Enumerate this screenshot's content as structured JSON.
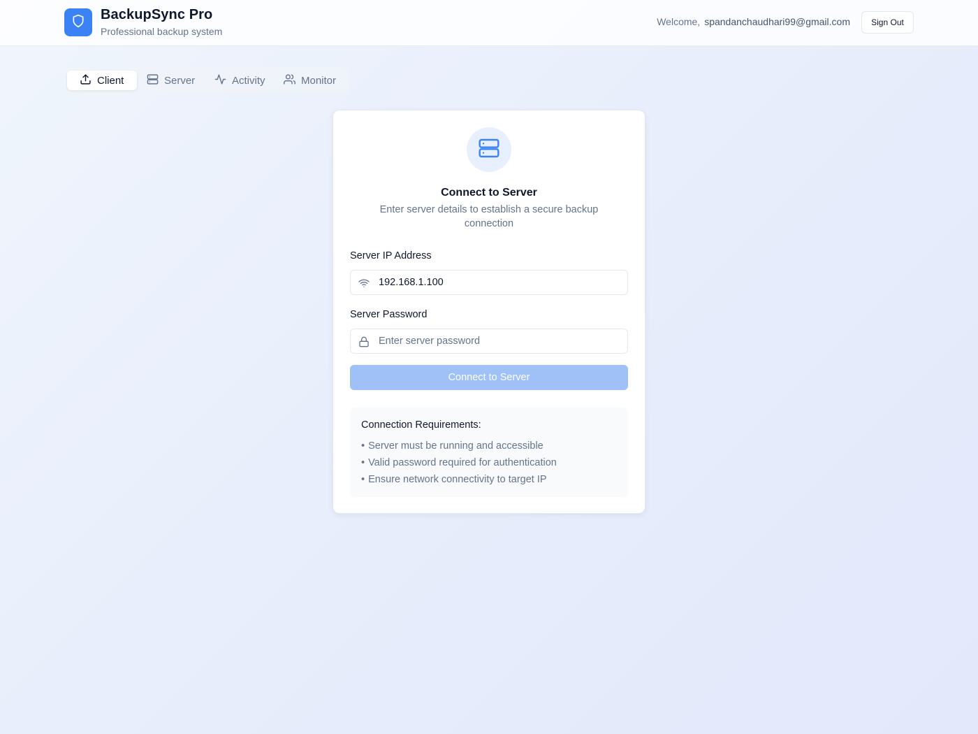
{
  "header": {
    "app_title": "BackupSync Pro",
    "app_subtitle": "Professional backup system",
    "welcome_label": "Welcome,",
    "user_email": "spandanchaudhari99@gmail.com",
    "sign_out_label": "Sign Out",
    "logo_icon": "shield-icon",
    "brand_color": "#3b82f6"
  },
  "tabs": [
    {
      "label": "Client",
      "icon": "upload-icon",
      "active": true
    },
    {
      "label": "Server",
      "icon": "server-icon",
      "active": false
    },
    {
      "label": "Activity",
      "icon": "activity-icon",
      "active": false
    },
    {
      "label": "Monitor",
      "icon": "users-icon",
      "active": false
    }
  ],
  "connect_card": {
    "icon": "server-icon",
    "title": "Connect to Server",
    "description": "Enter server details to establish a secure backup connection",
    "ip_label": "Server IP Address",
    "ip_value": "192.168.1.100",
    "ip_icon": "wifi-icon",
    "password_label": "Server Password",
    "password_placeholder": "Enter server password",
    "password_value": "",
    "password_icon": "lock-icon",
    "connect_button_label": "Connect to Server",
    "connect_button_color": "#9fc1f8",
    "requirements": {
      "title": "Connection Requirements:",
      "items": [
        "Server must be running and accessible",
        "Valid password required for authentication",
        "Ensure network connectivity to target IP"
      ]
    }
  }
}
